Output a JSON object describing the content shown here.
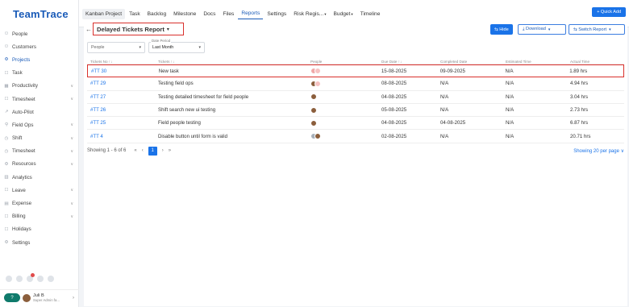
{
  "app": {
    "logo": "TeamTrace"
  },
  "sidebar": {
    "items": [
      {
        "label": "People",
        "icon": "person-icon",
        "glyph": "⚇",
        "active": false,
        "chevron": false
      },
      {
        "label": "Customers",
        "icon": "customers-icon",
        "glyph": "⚇",
        "active": false,
        "chevron": false
      },
      {
        "label": "Projects",
        "icon": "projects-icon",
        "glyph": "⚙",
        "active": true,
        "chevron": false
      },
      {
        "label": "Task",
        "icon": "task-icon",
        "glyph": "☐",
        "active": false,
        "chevron": false
      },
      {
        "label": "Productivity",
        "icon": "productivity-icon",
        "glyph": "▦",
        "active": false,
        "chevron": true
      },
      {
        "label": "Timesheet",
        "icon": "timesheet-icon",
        "glyph": "☐",
        "active": false,
        "chevron": true
      },
      {
        "label": "Auto-Pilot",
        "icon": "autopilot-icon",
        "glyph": "↗",
        "active": false,
        "chevron": false
      },
      {
        "label": "Field Ops",
        "icon": "fieldops-icon",
        "glyph": "⚲",
        "active": false,
        "chevron": true
      },
      {
        "label": "Shift",
        "icon": "shift-icon",
        "glyph": "◷",
        "active": false,
        "chevron": true
      },
      {
        "label": "Timesheet",
        "icon": "timesheet-2-icon",
        "glyph": "◷",
        "active": false,
        "chevron": true
      },
      {
        "label": "Resources",
        "icon": "resources-icon",
        "glyph": "⚙",
        "active": false,
        "chevron": true
      },
      {
        "label": "Analytics",
        "icon": "analytics-icon",
        "glyph": "▥",
        "active": false,
        "chevron": false
      },
      {
        "label": "Leave",
        "icon": "leave-icon",
        "glyph": "☐",
        "active": false,
        "chevron": true
      },
      {
        "label": "Expense",
        "icon": "expense-icon",
        "glyph": "▤",
        "active": false,
        "chevron": true
      },
      {
        "label": "Billing",
        "icon": "billing-icon",
        "glyph": "☐",
        "active": false,
        "chevron": true
      },
      {
        "label": "Holidays",
        "icon": "holidays-icon",
        "glyph": "☐",
        "active": false,
        "chevron": false
      },
      {
        "label": "Settings",
        "icon": "settings-icon",
        "glyph": "⚙",
        "active": false,
        "chevron": false
      }
    ],
    "user": {
      "name": "Juli B",
      "role": "Super Admin fa..."
    }
  },
  "topbar": {
    "tabs": [
      {
        "label": "Kanban Project",
        "dropdown": false
      },
      {
        "label": "Task",
        "dropdown": false
      },
      {
        "label": "Backlog",
        "dropdown": false
      },
      {
        "label": "Milestone",
        "dropdown": false
      },
      {
        "label": "Docs",
        "dropdown": false
      },
      {
        "label": "Files",
        "dropdown": false
      },
      {
        "label": "Reports",
        "dropdown": false
      },
      {
        "label": "Settings",
        "dropdown": false
      },
      {
        "label": "Risk Regis...",
        "dropdown": true
      },
      {
        "label": "Budget",
        "dropdown": true
      },
      {
        "label": "Timeline",
        "dropdown": false
      }
    ],
    "active_tab": "Reports",
    "quick_add": "+ Quick Add"
  },
  "report": {
    "title": "Delayed Tickets Report",
    "hide_label": "⇆ Hide",
    "download_label": "⤓ Download",
    "switch_label": "⇆ Switch Report"
  },
  "filters": {
    "people_placeholder": "People",
    "date_label": "Date Period",
    "date_value": "Last Month"
  },
  "table": {
    "headers": [
      "Tickets No ↑↓",
      "Tickets ↑↓",
      "People",
      "Due Date ↑↓",
      "Completed Date",
      "Estimated Time",
      "Actual Time"
    ],
    "rows": [
      {
        "id": "#TT 30",
        "ticket": "New task",
        "people": [
          "light",
          "pale"
        ],
        "due": "15-08-2025",
        "completed": "09-09-2025",
        "estimated": "N/A",
        "actual": "1.89 hrs",
        "highlight": true
      },
      {
        "id": "#TT 29",
        "ticket": "Testing field ops",
        "people": [
          "brown",
          "pale"
        ],
        "due": "08-08-2025",
        "completed": "N/A",
        "estimated": "N/A",
        "actual": "4.94 hrs",
        "highlight": false
      },
      {
        "id": "#TT 27",
        "ticket": "Testing detailed timesheet for field people",
        "people": [
          "brown"
        ],
        "due": "04-08-2025",
        "completed": "N/A",
        "estimated": "N/A",
        "actual": "3.04 hrs",
        "highlight": false
      },
      {
        "id": "#TT 26",
        "ticket": "Shift search new ui testing",
        "people": [
          "brown"
        ],
        "due": "05-08-2025",
        "completed": "N/A",
        "estimated": "N/A",
        "actual": "2.73 hrs",
        "highlight": false
      },
      {
        "id": "#TT 25",
        "ticket": "Field people testing",
        "people": [
          "brown"
        ],
        "due": "04-08-2025",
        "completed": "04-08-2025",
        "estimated": "N/A",
        "actual": "6.87 hrs",
        "highlight": false
      },
      {
        "id": "#TT 4",
        "ticket": "Disable button until form is valid",
        "people": [
          "gray",
          "brown"
        ],
        "due": "02-08-2025",
        "completed": "N/A",
        "estimated": "N/A",
        "actual": "20.71 hrs",
        "highlight": false
      }
    ]
  },
  "pagination": {
    "showing": "Showing 1 - 6 of 6",
    "first": "«",
    "prev": "‹",
    "current": "1",
    "next": "›",
    "last": "»",
    "per_page": "Showing 20 per page ∨"
  }
}
